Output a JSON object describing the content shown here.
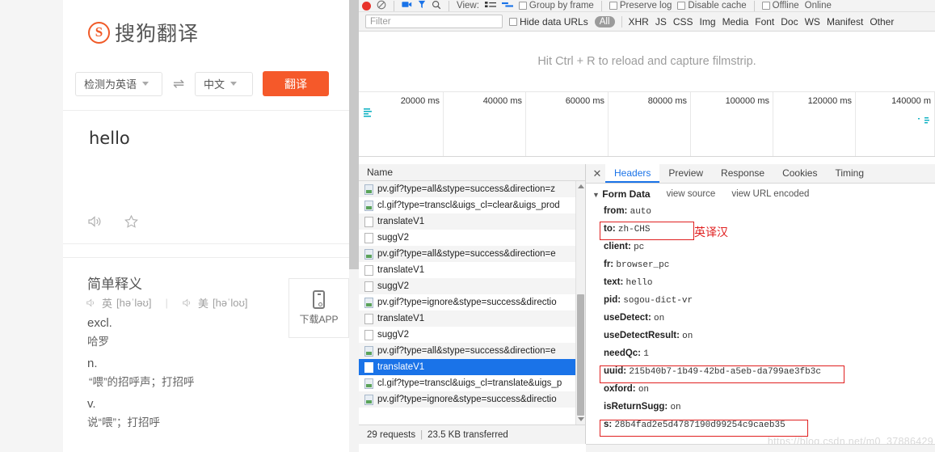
{
  "translate_page": {
    "logo_letter": "S",
    "logo_text": "搜狗翻译",
    "source_lang": "检测为英语",
    "swap_icon": "⇌",
    "target_lang": "中文",
    "translate_button": "翻译",
    "input_text": "hello",
    "dict": {
      "title": "简单释义",
      "uk_label": "英",
      "uk_phonetic": "[həˈləʊ]",
      "us_label": "美",
      "us_phonetic": "[həˈloʊ]",
      "entries": [
        {
          "pos": "excl.",
          "definition": "哈罗"
        },
        {
          "pos": "n.",
          "definition": "“喂”的招呼声；打招呼"
        },
        {
          "pos": "v.",
          "definition": "说“喂”；打招呼"
        }
      ]
    },
    "app_box_label": "下载APP"
  },
  "devtools": {
    "toolbar": {
      "record_icon": "record-dot",
      "clear_icon": "clear-icon",
      "camera_icon": "camera-icon",
      "filter_funnel_icon": "funnel-icon",
      "search_icon": "search-icon",
      "view_label": "View:",
      "list_view_icon": "list-view-icon",
      "waterfall_view_icon": "waterfall-view-icon",
      "group_by_frame": "Group by frame",
      "preserve_log": "Preserve log",
      "disable_cache": "Disable cache",
      "offline": "Offline",
      "online": "Online"
    },
    "filterbar": {
      "filter_placeholder": "Filter",
      "filter_value": "",
      "hide_data_urls": "Hide data URLs",
      "types": [
        "All",
        "XHR",
        "JS",
        "CSS",
        "Img",
        "Media",
        "Font",
        "Doc",
        "WS",
        "Manifest",
        "Other"
      ],
      "selected_type": "All"
    },
    "filmstrip_hint": "Hit Ctrl + R to reload and capture filmstrip.",
    "overview_ticks": [
      "20000 ms",
      "40000 ms",
      "60000 ms",
      "80000 ms",
      "100000 ms",
      "120000 ms",
      "140000 m"
    ],
    "requests": {
      "column_header": "Name",
      "rows": [
        {
          "name": "pv.gif?type=all&stype=success&direction=z",
          "kind": "img",
          "selected": false
        },
        {
          "name": "cl.gif?type=transcl&uigs_cl=clear&uigs_prod",
          "kind": "img",
          "selected": false
        },
        {
          "name": "translateV1",
          "kind": "xhr",
          "selected": false
        },
        {
          "name": "suggV2",
          "kind": "xhr",
          "selected": false
        },
        {
          "name": "pv.gif?type=all&stype=success&direction=e",
          "kind": "img",
          "selected": false
        },
        {
          "name": "translateV1",
          "kind": "xhr",
          "selected": false
        },
        {
          "name": "suggV2",
          "kind": "xhr",
          "selected": false
        },
        {
          "name": "pv.gif?type=ignore&stype=success&directio",
          "kind": "img",
          "selected": false
        },
        {
          "name": "translateV1",
          "kind": "xhr",
          "selected": false
        },
        {
          "name": "suggV2",
          "kind": "xhr",
          "selected": false
        },
        {
          "name": "pv.gif?type=all&stype=success&direction=e",
          "kind": "img",
          "selected": false
        },
        {
          "name": "translateV1",
          "kind": "xhr",
          "selected": true
        },
        {
          "name": "cl.gif?type=transcl&uigs_cl=translate&uigs_p",
          "kind": "img",
          "selected": false
        },
        {
          "name": "pv.gif?type=ignore&stype=success&directio",
          "kind": "img",
          "selected": false
        }
      ]
    },
    "status": {
      "requests": "29 requests",
      "separator": "|",
      "transferred": "23.5 KB transferred"
    },
    "details": {
      "close_label": "✕",
      "tabs": [
        "Headers",
        "Preview",
        "Response",
        "Cookies",
        "Timing"
      ],
      "active_tab": "Headers",
      "form_data": {
        "section_title": "Form Data",
        "view_source": "view source",
        "view_url_encoded": "view URL encoded",
        "rows": [
          {
            "key": "from:",
            "value": "auto",
            "highlight": false
          },
          {
            "key": "to:",
            "value": "zh-CHS",
            "highlight": true
          },
          {
            "key": "client:",
            "value": "pc",
            "highlight": false
          },
          {
            "key": "fr:",
            "value": "browser_pc",
            "highlight": false
          },
          {
            "key": "text:",
            "value": "hello",
            "highlight": false
          },
          {
            "key": "pid:",
            "value": "sogou-dict-vr",
            "highlight": false
          },
          {
            "key": "useDetect:",
            "value": "on",
            "highlight": false
          },
          {
            "key": "useDetectResult:",
            "value": "on",
            "highlight": false
          },
          {
            "key": "needQc:",
            "value": "1",
            "highlight": false
          },
          {
            "key": "uuid:",
            "value": "215b40b7-1b49-42bd-a5eb-da799ae3fb3c",
            "highlight": true
          },
          {
            "key": "oxford:",
            "value": "on",
            "highlight": false
          },
          {
            "key": "isReturnSugg:",
            "value": "on",
            "highlight": false
          },
          {
            "key": "s:",
            "value": "28b4fad2e5d4787190d99254c9caeb35",
            "highlight": true
          }
        ]
      },
      "annotation": "英译汉"
    },
    "watermark": "https://blog.csdn.net/m0_37886429"
  }
}
